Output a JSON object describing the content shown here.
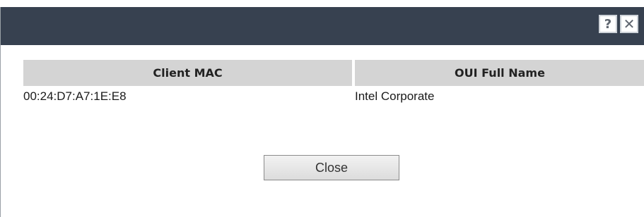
{
  "dialog": {
    "help_glyph": "?",
    "close_glyph": "✕"
  },
  "table": {
    "headers": [
      "Client MAC",
      "OUI Full Name"
    ],
    "rows": [
      [
        "00:24:D7:A7:1E:E8",
        "Intel Corporate"
      ]
    ]
  },
  "footer": {
    "close_label": "Close"
  },
  "colors": {
    "titlebar": "#374150",
    "header_bg": "#d4d4d4"
  }
}
